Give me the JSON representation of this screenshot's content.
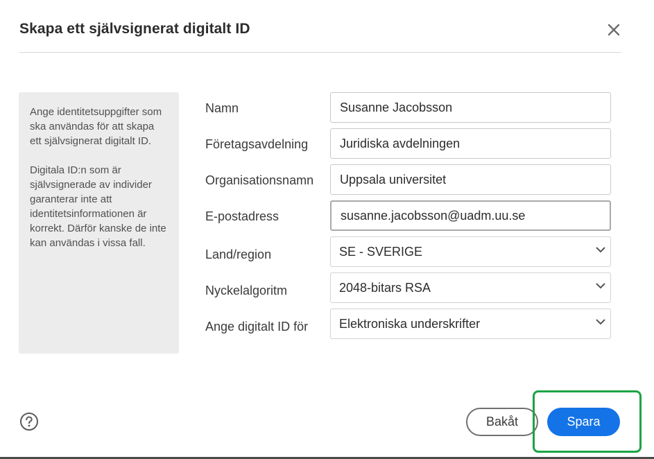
{
  "dialog": {
    "title": "Skapa ett självsignerat digitalt ID"
  },
  "info": {
    "paragraph1": "Ange identitetsuppgifter som ska användas för att skapa ett självsignerat digitalt ID.",
    "paragraph2": "Digitala ID:n som är självsignerade av individer garanterar inte att identitetsinformationen är korrekt. Därför kanske de inte kan användas i vissa fall."
  },
  "form": {
    "name": {
      "label": "Namn",
      "value": "Susanne Jacobsson"
    },
    "department": {
      "label": "Företagsavdelning",
      "value": "Juridiska avdelningen"
    },
    "organization": {
      "label": "Organisationsnamn",
      "value": "Uppsala universitet"
    },
    "email": {
      "label": "E-postadress",
      "value": "susanne.jacobsson@uadm.uu.se"
    },
    "country": {
      "label": "Land/region",
      "value": "SE - SVERIGE"
    },
    "key_algorithm": {
      "label": "Nyckelalgoritm",
      "value": "2048-bitars RSA"
    },
    "use_for": {
      "label": "Ange digitalt ID för",
      "value": "Elektroniska underskrifter"
    }
  },
  "footer": {
    "help_icon": "question-circle-icon",
    "back_label": "Bakåt",
    "save_label": "Spara"
  },
  "colors": {
    "primary": "#1473e6",
    "highlight": "#1ca345",
    "panel": "#ececec"
  }
}
